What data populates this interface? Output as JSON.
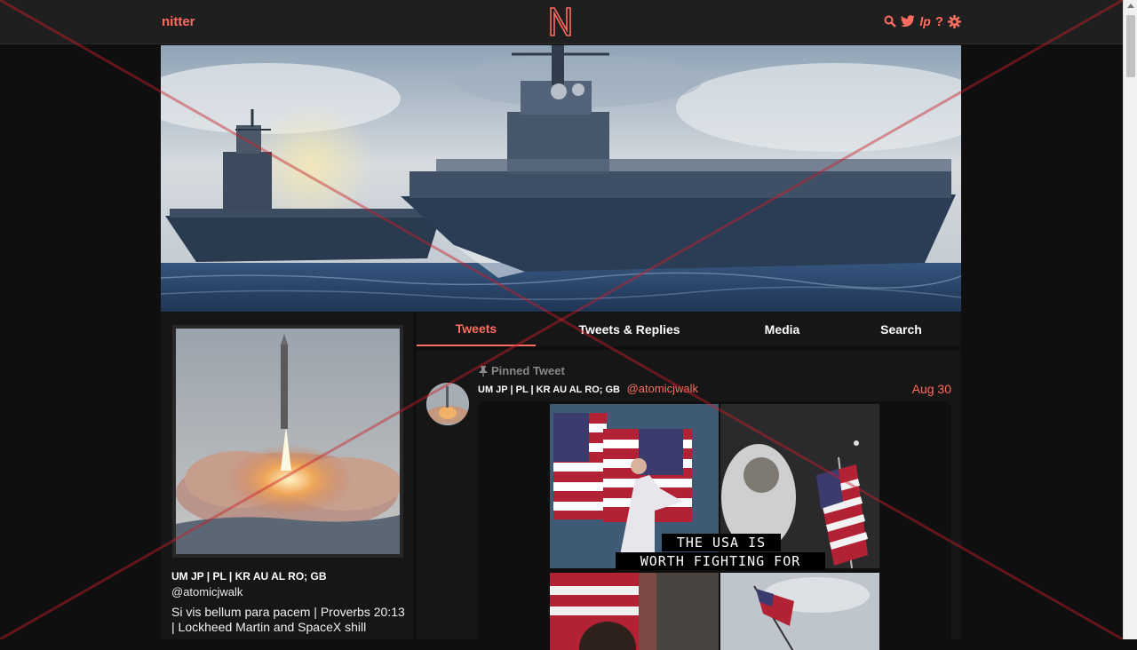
{
  "nav": {
    "brand": "nitter",
    "logo_letter": "N",
    "icons": [
      "search-icon",
      "twitter-icon",
      "liberapay-icon",
      "help-icon",
      "gear-icon"
    ]
  },
  "profile": {
    "fullname": "UM JP | PL | KR AU AL RO; GB",
    "username": "@atomicjwalk",
    "bio": "Si vis bellum para pacem | Proverbs 20:13 | Lockheed Martin and SpaceX shill"
  },
  "tabs": [
    {
      "label": "Tweets",
      "active": true
    },
    {
      "label": "Tweets & Replies",
      "active": false
    },
    {
      "label": "Media",
      "active": false
    },
    {
      "label": "Search",
      "active": false
    }
  ],
  "tweet": {
    "pinned_label": "Pinned Tweet",
    "fullname": "UM JP | PL | KR AU AL RO; GB",
    "username": "@atomicjwalk",
    "date": "Aug 30",
    "image_caption_line1": "THE USA IS",
    "image_caption_line2": "WORTH FIGHTING FOR"
  },
  "colors": {
    "accent": "#ff6c60",
    "background": "#0f0f0f",
    "panel": "#161616",
    "navbar": "#1f1f1f"
  }
}
